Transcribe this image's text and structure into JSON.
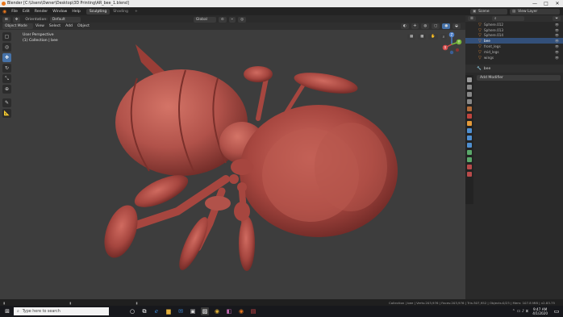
{
  "window": {
    "title": "Blender [C:\\Users\\Owner\\Desktop\\3D Printing\\AR_bee_1.blend]",
    "minimize_icon": "—",
    "maximize_icon": "□",
    "close_icon": "✕"
  },
  "menu": {
    "items": [
      "File",
      "Edit",
      "Render",
      "Window",
      "Help"
    ],
    "workspaces": [
      "Sculpting",
      "Shading"
    ],
    "add_tab": "+",
    "scene_label": "Scene",
    "view_layer_label": "View Layer"
  },
  "header2": {
    "orientation_label": "Orientation:",
    "orientation_value": "Default",
    "transform_space": "Global"
  },
  "header3": {
    "mode": "Object Mode",
    "menus": [
      "View",
      "Select",
      "Add",
      "Object"
    ]
  },
  "viewport": {
    "perspective_label": "User Perspective",
    "collection_label": "(1) Collection | bee"
  },
  "gizmo": {
    "z": "Z",
    "y": "Y",
    "x": "X"
  },
  "outliner": {
    "items": [
      {
        "name": "Sphere.012",
        "selected": false
      },
      {
        "name": "Sphere.013",
        "selected": false
      },
      {
        "name": "Sphere.014",
        "selected": false
      },
      {
        "name": "bee",
        "selected": true
      },
      {
        "name": "front_legs",
        "selected": false
      },
      {
        "name": "mid_legs",
        "selected": false
      },
      {
        "name": "wings",
        "selected": false
      }
    ]
  },
  "properties": {
    "object_name": "bee",
    "add_modifier_label": "Add Modifier"
  },
  "statusbar": {
    "text": "Collection | bee | Verts:203,976 | Faces:203,976 | Tris:307,952 | Objects:0/23 | Mem: 107.8 MiB | v2.83.75"
  },
  "taskbar": {
    "search_placeholder": "Type here to search",
    "time": "9:47 AM",
    "date": "4/1/2020"
  },
  "colors": {
    "accent": "#4672a8",
    "bee_body": "#b1524a",
    "viewport_bg": "#3d3d3d",
    "selected_row": "#33507a"
  }
}
